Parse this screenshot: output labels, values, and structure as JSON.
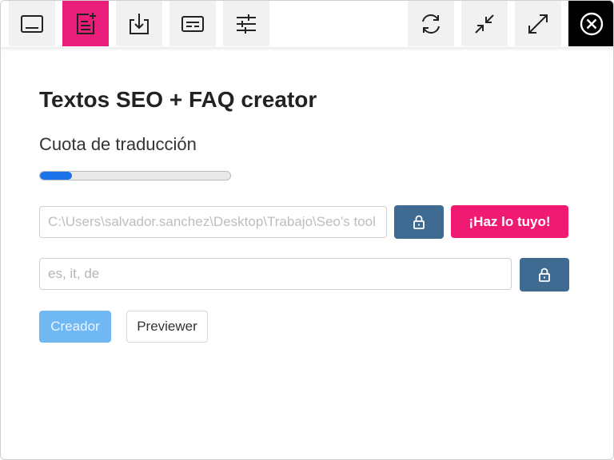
{
  "toolbar": {
    "left_buttons": [
      {
        "icon": "panel-icon"
      },
      {
        "icon": "new-document-icon",
        "active": true
      },
      {
        "icon": "download-icon"
      },
      {
        "icon": "subtitles-icon"
      },
      {
        "icon": "sliders-icon"
      }
    ],
    "right_buttons": [
      {
        "icon": "refresh-icon"
      },
      {
        "icon": "minimize-icon"
      },
      {
        "icon": "maximize-icon"
      },
      {
        "icon": "close-icon"
      }
    ],
    "active_color": "#e91e7a"
  },
  "main": {
    "title": "Textos SEO + FAQ creator",
    "quota_label": "Cuota de traducción",
    "quota_progress_fraction": 0.17,
    "path_input": {
      "value": "C:\\Users\\salvador.sanchez\\Desktop\\Trabajo\\Seo's tool"
    },
    "languages_input": {
      "value": "",
      "placeholder": "es, it, de"
    },
    "cta_label": "¡Haz lo tuyo!",
    "creador_label": "Creador",
    "previewer_label": "Previewer"
  },
  "colors": {
    "accent_pink": "#f01a72",
    "lock_button": "#3f6a92",
    "progress_fill": "#1a73e8",
    "creador_button": "#6fb8f3"
  }
}
